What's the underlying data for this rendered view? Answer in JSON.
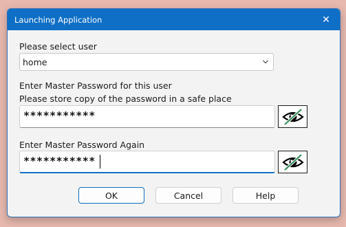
{
  "window": {
    "title": "Launching Application",
    "close_glyph": "✕"
  },
  "user_select": {
    "label": "Please select user",
    "value": "home",
    "chevron_icon": "chevron-down-icon"
  },
  "password": {
    "label": "Enter Master Password for this user",
    "note": "Please store copy of the password in a safe place",
    "value": "***********",
    "toggle_icon": "eye-slash-icon"
  },
  "password_again": {
    "label": "Enter Master Password Again",
    "value": "***********",
    "toggle_icon": "eye-slash-icon"
  },
  "buttons": {
    "ok": "OK",
    "cancel": "Cancel",
    "help": "Help"
  },
  "colors": {
    "title_bar": "#0f6fc6",
    "eye_accent": "#2e8b57",
    "background": "#e6b8ae"
  }
}
